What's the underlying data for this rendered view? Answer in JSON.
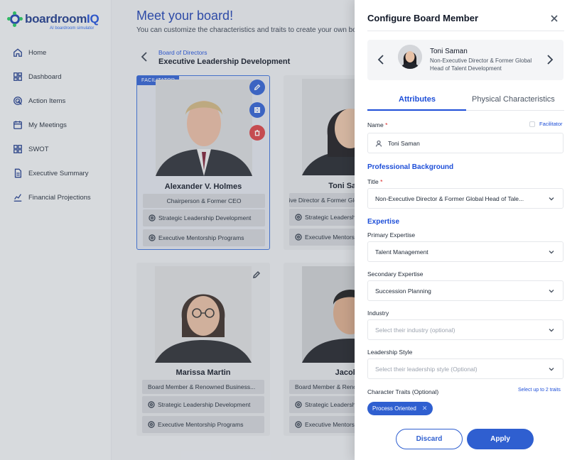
{
  "brand": {
    "name_prefix": "boardroom",
    "name_suffix": "IQ",
    "tagline": "AI boardroom simulator"
  },
  "nav": [
    {
      "label": "Home",
      "icon": "home-icon"
    },
    {
      "label": "Dashboard",
      "icon": "dashboard-icon"
    },
    {
      "label": "Action Items",
      "icon": "target-icon"
    },
    {
      "label": "My Meetings",
      "icon": "calendar-icon"
    },
    {
      "label": "SWOT",
      "icon": "grid-icon"
    },
    {
      "label": "Executive Summary",
      "icon": "document-icon"
    },
    {
      "label": "Financial Projections",
      "icon": "chart-icon"
    }
  ],
  "main": {
    "title": "Meet your board!",
    "subtitle": "You can customize the characteristics and traits to create your own board",
    "breadcrumb": "Board of Directors",
    "board_name": "Executive Leadership Development",
    "cards": [
      {
        "badge": "FACILITATOR",
        "name": "Alexander V. Holmes",
        "title": "Chairperson & Former CEO",
        "tags": [
          "Strategic Leadership Development",
          "Executive Mentorship Programs"
        ]
      },
      {
        "name": "Toni Saman",
        "title": "Non-Executive Director & Former Global Head of Talent Development",
        "tags": [
          "Strategic Leadership Development",
          "Executive Mentorship Programs"
        ]
      },
      {
        "name": "Marissa Martin",
        "title": "Board Member & Renowned Business...",
        "tags": [
          "Strategic Leadership Development",
          "Executive Mentorship Programs"
        ]
      },
      {
        "name": "Jacob K",
        "title": "Board Member & Renowned Business...",
        "tags": [
          "Strategic Leadership Development",
          "Executive Mentorship Programs"
        ]
      }
    ]
  },
  "panel": {
    "title": "Configure Board Member",
    "member": {
      "name": "Toni Saman",
      "title": "Non-Executive Director & Former Global Head of Talent Development"
    },
    "tabs": {
      "attributes": "Attributes",
      "physical": "Physical Characteristics"
    },
    "name_label": "Name",
    "facilitator_label": "Facilitator",
    "name_value": "Toni Saman",
    "section_background": "Professional Background",
    "title_label": "Title",
    "title_value": "Non-Executive Director & Former Global Head of Tale...",
    "section_expertise": "Expertise",
    "primary_label": "Primary Expertise",
    "primary_value": "Talent Management",
    "secondary_label": "Secondary Expertise",
    "secondary_value": "Succession Planning",
    "industry_label": "Industry",
    "industry_placeholder": "Select their industry (optional)",
    "leadership_label": "Leadership Style",
    "leadership_placeholder": "Select their leadership style (Optional)",
    "traits_label": "Character Traits (Optional)",
    "traits_hint": "Select up to 2 traits",
    "traits": [
      "Process Oriented"
    ],
    "discard": "Discard",
    "apply": "Apply"
  },
  "colors": {
    "accent": "#2f5fd0",
    "danger": "#d64045",
    "brand": "#1e3a8a"
  }
}
